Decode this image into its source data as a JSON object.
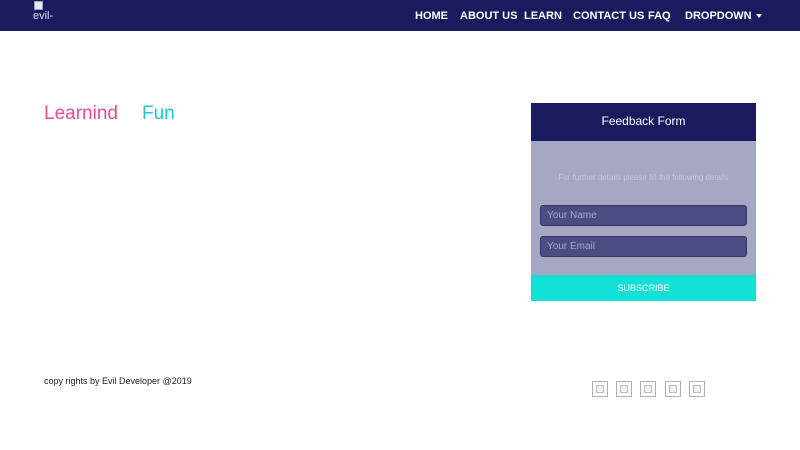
{
  "header": {
    "logo_alt": "evil-",
    "nav": [
      {
        "label": "HOME"
      },
      {
        "label": "ABOUT US"
      },
      {
        "label": "LEARN"
      },
      {
        "label": "CONTACT US"
      },
      {
        "label": "FAQ"
      },
      {
        "label": "DROPDOWN"
      }
    ]
  },
  "hero": {
    "word1": "Learnind",
    "word2": "Fun"
  },
  "feedback": {
    "title": "Feedback Form",
    "note": "For further details please fill the following details",
    "name_placeholder": "Your Name",
    "email_placeholder": "Your Email",
    "submit_label": "SUBSCRIBE"
  },
  "footer": {
    "copyright": "copy rights by Evil Developer @2019"
  },
  "colors": {
    "navbar": "#1a1b5e",
    "accent_pink": "#e8489a",
    "accent_cyan": "#19c9d6",
    "subscribe": "#14e1d6"
  }
}
